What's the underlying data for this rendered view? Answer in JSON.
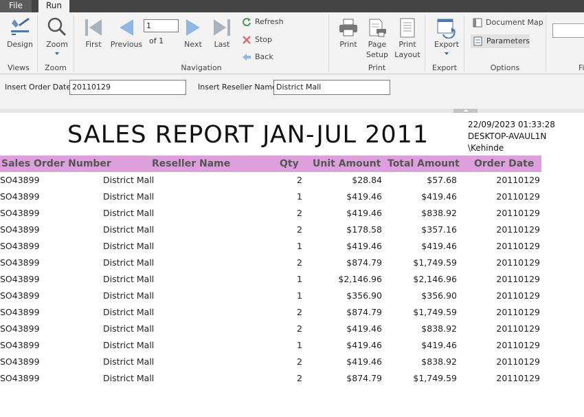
{
  "tabs": {
    "file": "File",
    "run": "Run"
  },
  "ribbon": {
    "views": {
      "design_label": "Design",
      "group": "Views"
    },
    "zoom": {
      "zoom_label": "Zoom",
      "group": "Zoom"
    },
    "navigation": {
      "first": "First",
      "previous": "Previous",
      "next": "Next",
      "last": "Last",
      "page_value": "1",
      "of_text": "of  1",
      "refresh": "Refresh",
      "stop": "Stop",
      "back": "Back",
      "group": "Navigation"
    },
    "print": {
      "print": "Print",
      "page_setup_1": "Page",
      "page_setup_2": "Setup",
      "print_layout_1": "Print",
      "print_layout_2": "Layout",
      "group": "Print"
    },
    "export": {
      "export": "Export",
      "group": "Export"
    },
    "options": {
      "document_map": "Document Map",
      "parameters": "Parameters",
      "group": "Options"
    },
    "find": {
      "group_partial": "Fi"
    }
  },
  "params": {
    "order_date_label": "Insert Order Date",
    "order_date_value": "20110129",
    "reseller_label": "Insert Reseller Name",
    "reseller_value": "District Mall"
  },
  "report": {
    "title": "SALES REPORT JAN-JUL 2011",
    "timestamp": "22/09/2023 01:33:28",
    "machine": "DESKTOP-AVAUL1N",
    "user": "\\Kehinde",
    "columns": [
      "Sales Order Number",
      "Reseller Name",
      "Qty",
      "Unit Amount",
      "Total Amount",
      "Order Date"
    ],
    "rows": [
      [
        "SO43899",
        "District Mall",
        "2",
        "$28.84",
        "$57.68",
        "20110129"
      ],
      [
        "SO43899",
        "District Mall",
        "1",
        "$419.46",
        "$419.46",
        "20110129"
      ],
      [
        "SO43899",
        "District Mall",
        "2",
        "$419.46",
        "$838.92",
        "20110129"
      ],
      [
        "SO43899",
        "District Mall",
        "2",
        "$178.58",
        "$357.16",
        "20110129"
      ],
      [
        "SO43899",
        "District Mall",
        "1",
        "$419.46",
        "$419.46",
        "20110129"
      ],
      [
        "SO43899",
        "District Mall",
        "2",
        "$874.79",
        "$1,749.59",
        "20110129"
      ],
      [
        "SO43899",
        "District Mall",
        "1",
        "$2,146.96",
        "$2,146.96",
        "20110129"
      ],
      [
        "SO43899",
        "District Mall",
        "1",
        "$356.90",
        "$356.90",
        "20110129"
      ],
      [
        "SO43899",
        "District Mall",
        "2",
        "$874.79",
        "$1,749.59",
        "20110129"
      ],
      [
        "SO43899",
        "District Mall",
        "2",
        "$419.46",
        "$838.92",
        "20110129"
      ],
      [
        "SO43899",
        "District Mall",
        "1",
        "$419.46",
        "$419.46",
        "20110129"
      ],
      [
        "SO43899",
        "District Mall",
        "2",
        "$419.46",
        "$838.92",
        "20110129"
      ],
      [
        "SO43899",
        "District Mall",
        "2",
        "$874.79",
        "$1,749.59",
        "20110129"
      ]
    ]
  },
  "colors": {
    "header_bg": "#dda0dd",
    "ribbon_bg": "#f3f3f3",
    "nav_disabled": "#9aa7b6",
    "nav_blue": "#8fb7e6"
  }
}
